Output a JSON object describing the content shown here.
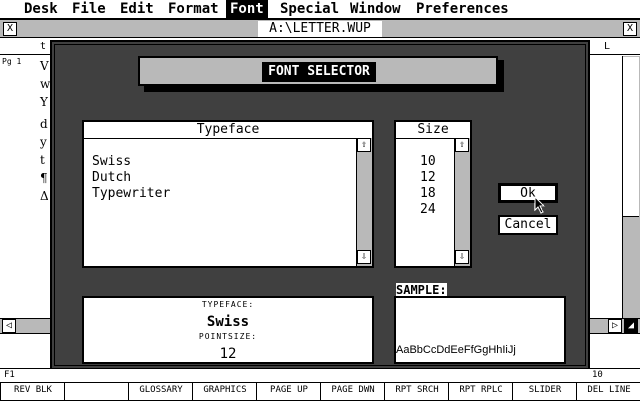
{
  "menubar": {
    "items": [
      {
        "label": "Desk"
      },
      {
        "label": "File"
      },
      {
        "label": "Edit"
      },
      {
        "label": "Format"
      },
      {
        "label": "Font"
      },
      {
        "label": "Special"
      },
      {
        "label": "Window"
      },
      {
        "label": "Preferences"
      }
    ],
    "active_index": 4
  },
  "window": {
    "title": "A:\\LETTER.WUP",
    "close_glyph": "X",
    "full_glyph": "X",
    "ruler_left": "t",
    "ruler_right": "L",
    "page_indicator": "Pg 1",
    "doc_chars": [
      "V",
      "w",
      "Y",
      "d",
      "y",
      "t",
      "¶",
      "Δ"
    ],
    "status_left": "F1",
    "status_right": "10"
  },
  "dialog": {
    "title": "FONT SELECTOR",
    "typeface_header": "Typeface",
    "size_header": "Size",
    "typefaces": [
      "Swiss",
      "Dutch",
      "Typewriter"
    ],
    "sizes": [
      "10",
      "12",
      "18",
      "24"
    ],
    "ok_label": "Ok",
    "cancel_label": "Cancel",
    "info": {
      "typeface_caption": "TYPEFACE:",
      "typeface_value": "Swiss",
      "pointsize_caption": "POINTSIZE:",
      "pointsize_value": "12"
    },
    "sample_label": "SAMPLE:",
    "sample_text": "AaBbCcDdEeFfGgHhIiJj",
    "up_arrow": "⇧",
    "down_arrow": "⇩"
  },
  "function_keys": [
    {
      "label": "REV BLK"
    },
    {
      "label": ""
    },
    {
      "label": "GLOSSARY"
    },
    {
      "label": "GRAPHICS"
    },
    {
      "label": "PAGE UP"
    },
    {
      "label": "PAGE DWN"
    },
    {
      "label": "RPT SRCH"
    },
    {
      "label": "RPT RPLC"
    },
    {
      "label": "SLIDER"
    },
    {
      "label": "DEL LINE"
    }
  ]
}
